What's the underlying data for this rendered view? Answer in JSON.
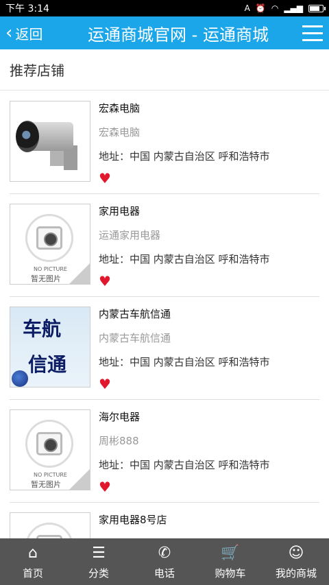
{
  "status": {
    "time": "下午 3:14"
  },
  "header": {
    "back_label": "返回",
    "title": "运通商城官网 - 运通商城"
  },
  "section": {
    "title": "推荐店铺"
  },
  "shops": [
    {
      "name": "宏森电脑",
      "sub": "宏森电脑",
      "addr": "地址：中国 内蒙古自治区 呼和浩特市"
    },
    {
      "name": "家用电器",
      "sub": "运通家用电器",
      "addr": "地址：中国 内蒙古自治区 呼和浩特市"
    },
    {
      "name": "内蒙古车航信通",
      "sub": "内蒙古车航信通",
      "addr": "地址：中国 内蒙古自治区 呼和浩特市"
    },
    {
      "name": "海尔电器",
      "sub": "周彬888",
      "addr": "地址：中国 内蒙古自治区 呼和浩特市"
    },
    {
      "name": "家用电器8号店",
      "sub": "",
      "addr": ""
    }
  ],
  "images": {
    "noimg_en": "NO PICTURE",
    "noimg_cn": "暂无图片",
    "nav_line1": "车航",
    "nav_line2": "信通"
  },
  "tabs": [
    {
      "label": "首页",
      "icon": "home-icon"
    },
    {
      "label": "分类",
      "icon": "list-icon"
    },
    {
      "label": "电话",
      "icon": "phone-icon"
    },
    {
      "label": "购物车",
      "icon": "cart-icon"
    },
    {
      "label": "我的商城",
      "icon": "user-icon"
    }
  ],
  "colors": {
    "header_bg": "#1aa6e8",
    "tabbar_bg": "#555555",
    "heart": "#e0182d"
  }
}
